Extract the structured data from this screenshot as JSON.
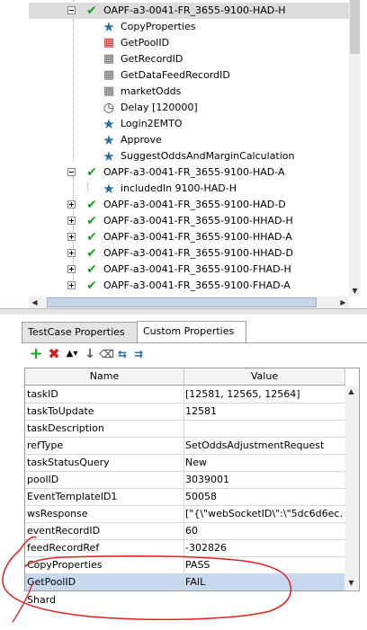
{
  "tree": {
    "selected_case": "OAPF-a3-0041-FR_3655-9100-HAD-H",
    "selected_children": [
      {
        "label": "CopyProperties",
        "icon": "star-icon"
      },
      {
        "label": "GetPoolID",
        "icon": "grid-red-icon"
      },
      {
        "label": "GetRecordID",
        "icon": "grid-icon"
      },
      {
        "label": "GetDataFeedRecordID",
        "icon": "grid-icon"
      },
      {
        "label": "marketOdds",
        "icon": "grid-icon"
      },
      {
        "label": "Delay [120000]",
        "icon": "clock-icon"
      },
      {
        "label": "Login2EMTO",
        "icon": "star-icon"
      },
      {
        "label": "Approve",
        "icon": "star-icon"
      },
      {
        "label": "SuggestOddsAndMarginCalculation",
        "icon": "star-icon"
      }
    ],
    "second_case": "OAPF-a3-0041-FR_3655-9100-HAD-A",
    "second_children": [
      {
        "label": "includedIn 9100-HAD-H",
        "icon": "star-icon"
      }
    ],
    "collapsed_cases": [
      "OAPF-a3-0041-FR_3655-9100-HAD-D",
      "OAPF-a3-0041-FR_3655-9100-HHAD-H",
      "OAPF-a3-0041-FR_3655-9100-HHAD-A",
      "OAPF-a3-0041-FR_3655-9100-HHAD-D",
      "OAPF-a3-0041-FR_3655-9100-FHAD-H",
      "OAPF-a3-0041-FR_3655-9100-FHAD-A"
    ]
  },
  "tabs": {
    "testcase": "TestCase Properties",
    "custom": "Custom Properties"
  },
  "toolbar_icons": [
    "add-icon",
    "delete-icon",
    "move-up-icon",
    "move-down-icon",
    "clear-icon",
    "load-icon",
    "save-icon"
  ],
  "table": {
    "headers": {
      "name": "Name",
      "value": "Value"
    },
    "rows": [
      {
        "name": "taskID",
        "value": "[12581, 12565, 12564]"
      },
      {
        "name": "taskToUpdate",
        "value": "12581"
      },
      {
        "name": "taskDescription",
        "value": ""
      },
      {
        "name": "refType",
        "value": "SetOddsAdjustmentRequest"
      },
      {
        "name": "taskStatusQuery",
        "value": "New"
      },
      {
        "name": "poolID",
        "value": "3039001"
      },
      {
        "name": "EventTemplateID1",
        "value": "50058"
      },
      {
        "name": "wsResponse",
        "value": "[\"{\\\"webSocketID\\\":\\\"5dc6d6ec..."
      },
      {
        "name": "eventRecordID",
        "value": "60"
      },
      {
        "name": "feedRecordRef",
        "value": "-302826"
      },
      {
        "name": "CopyProperties",
        "value": "PASS"
      },
      {
        "name": "GetPoolID",
        "value": "FAIL"
      }
    ],
    "selected_row": "GetPoolID"
  },
  "footer_partial": "Shard",
  "colors": {
    "check": "#1f9a1f",
    "star": "#2e6f9e",
    "annotation": "#e02020",
    "selection": "#c8d9ef"
  }
}
